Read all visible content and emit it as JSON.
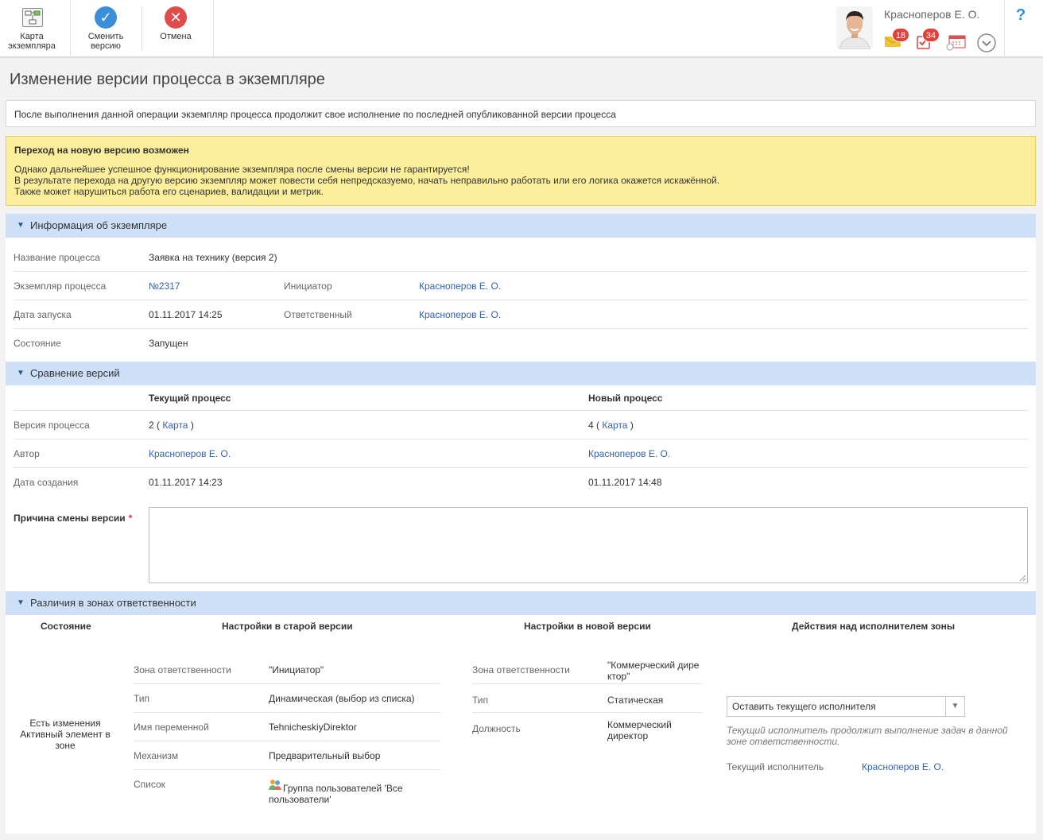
{
  "toolbar": {
    "map_label_1": "Карта",
    "map_label_2": "экземпляра",
    "change_label_1": "Сменить",
    "change_label_2": "версию",
    "cancel_label": "Отмена"
  },
  "user": {
    "name": "Красноперов Е. О.",
    "mail_count": "18",
    "tasks_count": "34"
  },
  "help": "?",
  "page": {
    "title": "Изменение версии процесса в экземпляре",
    "info": "После выполнения данной операции экземпляр процесса продолжит свое исполнение по последней опубликованной версии процесса",
    "warning_title": "Переход на новую версию возможен",
    "warning_line1": "Однако дальнейшее успешное функционирование экземпляра после смены версии не гарантируется!",
    "warning_line2": "В результате перехода на другую версию экземпляр может повести себя непредсказуемо, начать неправильно работать или его логика окажется искажённой.",
    "warning_line3": "Также может нарушиться работа его сценариев, валидации и метрик."
  },
  "instance_info": {
    "header": "Информация об экземпляре",
    "process_name_label": "Название процесса",
    "process_name": "Заявка на технику (версия 2)",
    "instance_label": "Экземпляр процесса",
    "instance": "№2317",
    "initiator_label": "Инициатор",
    "initiator": "Красноперов Е. О.",
    "start_label": "Дата запуска",
    "start": "01.11.2017 14:25",
    "responsible_label": "Ответственный",
    "responsible": "Красноперов Е. О.",
    "state_label": "Состояние",
    "state": "Запущен"
  },
  "compare": {
    "header": "Сравнение версий",
    "current_header": "Текущий процесс",
    "new_header": "Новый процесс",
    "version_label": "Версия процесса",
    "current_version": "2",
    "new_version": "4",
    "map_link": "Карта",
    "paren_open": "(",
    "paren_close": ")",
    "author_label": "Автор",
    "current_author": "Красноперов Е. О.",
    "new_author": "Красноперов Е. О.",
    "created_label": "Дата создания",
    "current_created": "01.11.2017 14:23",
    "new_created": "01.11.2017 14:48",
    "reason_label": "Причина смены версии",
    "required_mark": "*"
  },
  "zones": {
    "header": "Различия в зонах ответственности",
    "col_state": "Состояние",
    "col_old": "Настройки в старой версии",
    "col_new": "Настройки в новой версии",
    "col_actions": "Действия над исполнителем зоны",
    "state_1": "Есть изменения",
    "state_2": "Активный элемент в",
    "state_3": "зоне",
    "old": {
      "zone_label": "Зона ответственности",
      "zone": "\"Инициатор\"",
      "type_label": "Тип",
      "type": "Динамическая (выбор из списка)",
      "var_label": "Имя переменной",
      "var": "TehnicheskiyDirektor",
      "mech_label": "Механизм",
      "mech": "Предварительный выбор",
      "list_label": "Список",
      "list_1": "Группа пользователей 'Все",
      "list_2": "пользователи'"
    },
    "new": {
      "zone_label": "Зона ответственности",
      "zone_1": "\"Коммерческий  дире",
      "zone_2": "ктор\"",
      "type_label": "Тип",
      "type": "Статическая",
      "pos_label": "Должность",
      "pos_1": "Коммерческий",
      "pos_2": "директор"
    },
    "action_select": "Оставить текущего исполнителя",
    "action_hint_1": "Текущий исполнитель продолжит выполнение задач в данной",
    "action_hint_2": "зоне ответственности.",
    "current_exec_label": "Текущий исполнитель",
    "current_exec": "Красноперов Е. О."
  }
}
